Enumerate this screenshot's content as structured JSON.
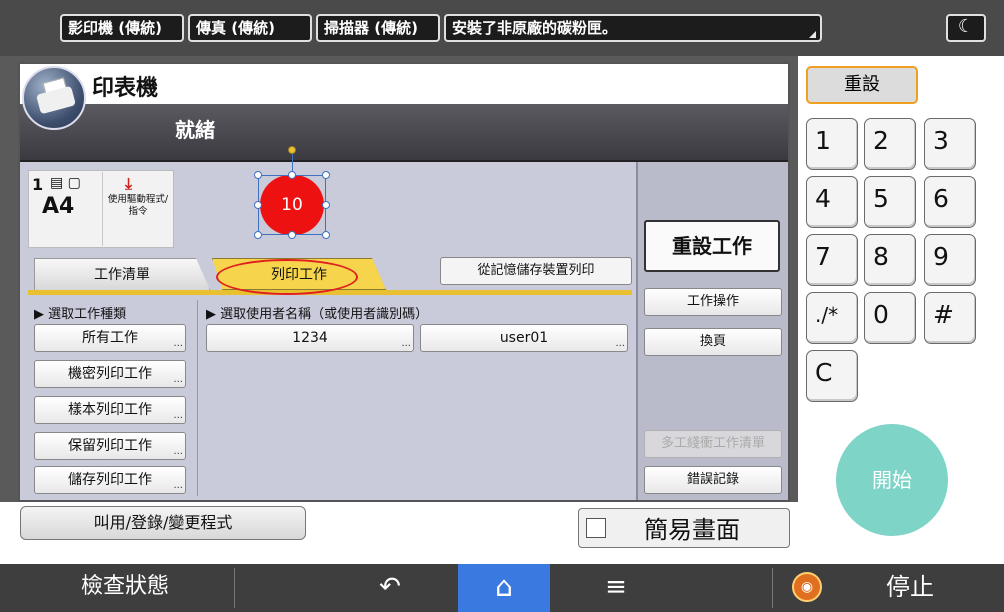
{
  "topbar": {
    "tabs": [
      "影印機 (傳統)",
      "傳真 (傳統)",
      "掃描器 (傳統)"
    ],
    "message": "安裝了非原廠的碳粉匣。",
    "night_icon": "moon-icon"
  },
  "keypad": {
    "reset": "重設",
    "keys": [
      "1",
      "2",
      "3",
      "4",
      "5",
      "6",
      "7",
      "8",
      "9",
      "./*",
      "0",
      "#",
      "C"
    ],
    "start": "開始"
  },
  "panel": {
    "title": "印表機",
    "status": "就緒",
    "tile": {
      "count": "1",
      "size": "A4",
      "driver": "使用驅動程式/指令"
    },
    "badge": "10",
    "tabs": {
      "job_list": "工作清單",
      "print_job": "列印工作"
    },
    "memory_print": "從記憶儲存裝置列印",
    "sections": {
      "job_type": "▶ 選取工作種類",
      "user": "▶ 選取使用者名稱（或使用者識別碼）"
    },
    "job_types": [
      "所有工作",
      "機密列印工作",
      "樣本列印工作",
      "保留列印工作",
      "儲存列印工作"
    ],
    "users": [
      "1234",
      "user01"
    ],
    "right_buttons": {
      "reset_job": "重設工作",
      "job_ops": "工作操作",
      "page_turn": "換頁",
      "multi_balance": "多工綫衝工作清單",
      "error_log": "錯誤記錄"
    },
    "program": "叫用/登錄/變更程式",
    "simple_screen": "簡易畫面"
  },
  "navbar": {
    "check_status": "檢查狀態",
    "back": "↶",
    "home": "⌂",
    "menu": "≡",
    "stop": "停止"
  },
  "colors": {
    "accent": "#f6d44c",
    "reset_border": "#f0a020",
    "start": "#7fd4c8",
    "home_active": "#3a7ae0",
    "badge": "#ee1111"
  }
}
